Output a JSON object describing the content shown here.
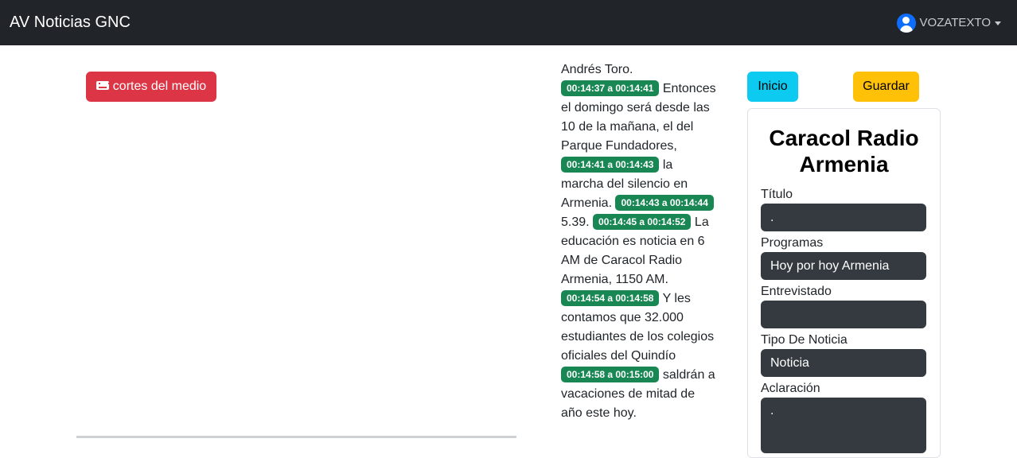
{
  "navbar": {
    "brand": "AV Noticias GNC",
    "user": "VOZATEXTO"
  },
  "left": {
    "cortes_label": "cortes del medio"
  },
  "transcript": {
    "partial_top": "Andrés Toro.",
    "entries": [
      {
        "time": "00:14:37 a 00:14:41",
        "text": "Entonces el domingo será desde las 10 de la mañana, el del Parque Fundadores,"
      },
      {
        "time": "00:14:41 a 00:14:43",
        "text": "la marcha del silencio en Armenia."
      },
      {
        "time": "00:14:43 a 00:14:44",
        "text": "5.39."
      },
      {
        "time": "00:14:45 a 00:14:52",
        "text": "La educación es noticia en 6 AM de Caracol Radio Armenia, 1150 AM."
      },
      {
        "time": "00:14:54 a 00:14:58",
        "text": "Y les contamos que 32.000 estudiantes de los colegios oficiales del Quindío"
      },
      {
        "time": "00:14:58 a 00:15:00",
        "text": "saldrán a vacaciones de mitad de año este hoy."
      }
    ]
  },
  "actions": {
    "inicio": "Inicio",
    "guardar": "Guardar"
  },
  "form": {
    "title": "Caracol Radio Armenia",
    "titulo_label": "Título",
    "titulo_value": ".",
    "programas_label": "Programas",
    "programas_value": "Hoy por hoy Armenia",
    "entrevistado_label": "Entrevistado",
    "entrevistado_value": "",
    "tipo_label": "Tipo De Noticia",
    "tipo_value": "Noticia",
    "aclaracion_label": "Aclaración",
    "aclaracion_value": "."
  },
  "colors": {
    "navbar": "#212529",
    "danger": "#dc3545",
    "success": "#198754",
    "info": "#0dcaf0",
    "warning": "#ffc107",
    "field": "#343a40"
  }
}
